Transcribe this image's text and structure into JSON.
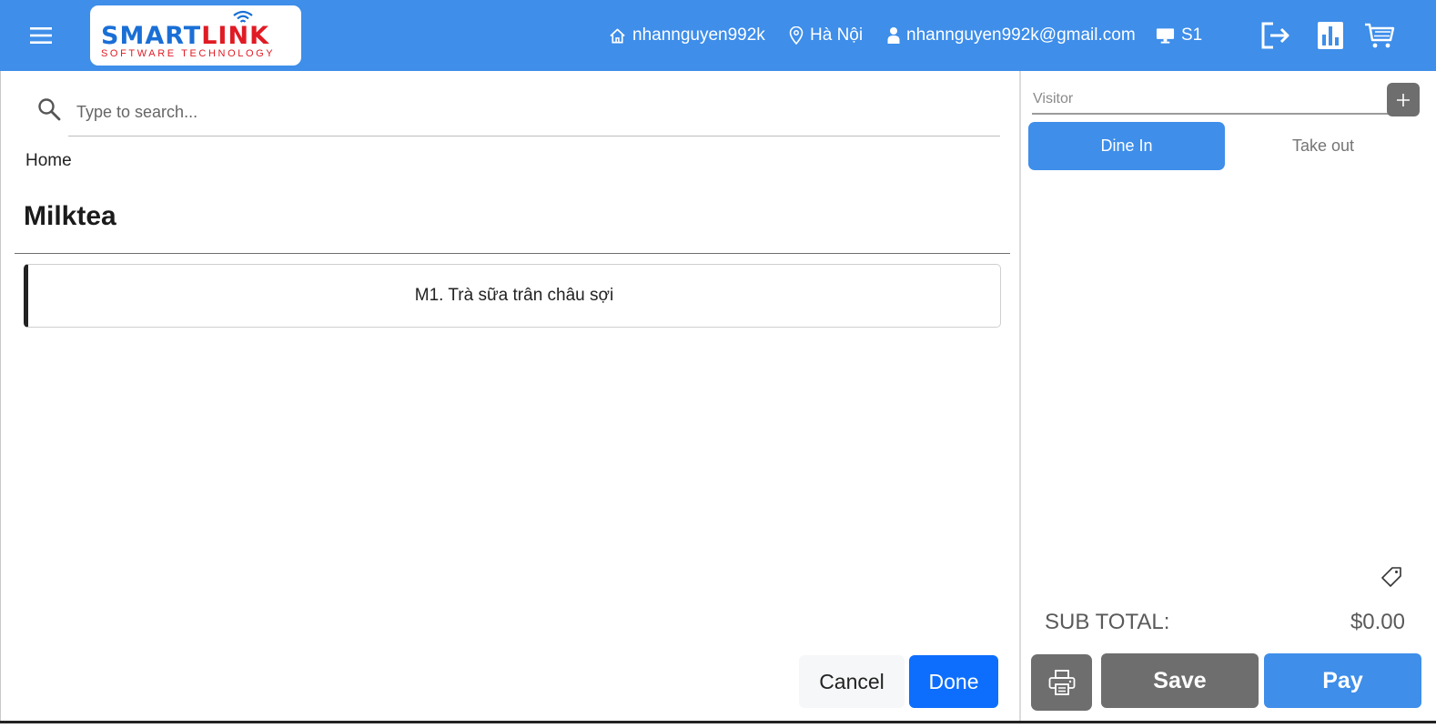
{
  "header": {
    "logo": {
      "brand_part1": "SMART",
      "brand_part2": "LINK",
      "tagline": "SOFTWARE TECHNOLOGY"
    },
    "user_name": "nhannguyen992k",
    "location": "Hà Nội",
    "email": "nhannguyen992k@gmail.com",
    "station": "S1",
    "icons": [
      "menu-icon",
      "home-icon",
      "map-pin-icon",
      "user-icon",
      "monitor-icon",
      "logout-icon",
      "bar-chart-icon",
      "cart-icon"
    ]
  },
  "search": {
    "placeholder": "Type to search...",
    "value": ""
  },
  "breadcrumb": "Home",
  "category": {
    "title": "Milktea"
  },
  "items": [
    {
      "label": "M1. Trà sữa trân châu sợi"
    }
  ],
  "actions": {
    "cancel_label": "Cancel",
    "done_label": "Done"
  },
  "order": {
    "visitor_placeholder": "Visitor",
    "visitor_value": "",
    "tabs": [
      {
        "label": "Dine In",
        "active": true
      },
      {
        "label": "Take out",
        "active": false
      }
    ],
    "subtotal_label": "SUB TOTAL:",
    "subtotal_value": "$0.00",
    "save_label": "Save",
    "pay_label": "Pay"
  },
  "colors": {
    "primary": "#3e8eea",
    "done_button": "#0d6efd",
    "neutral_button": "#6e6e6e",
    "brand_blue": "#1a6fd6",
    "brand_red": "#e01b24"
  }
}
